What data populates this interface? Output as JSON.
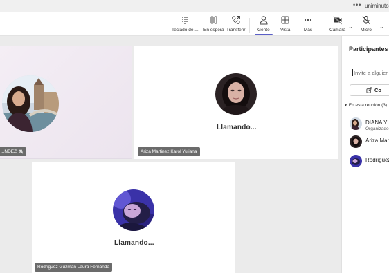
{
  "browser": {
    "menu_dots": "•••",
    "domain": "uniminuto.e"
  },
  "toolbar": {
    "items": [
      {
        "label": "Teclado de ...",
        "icon": "dialpad-icon"
      },
      {
        "label": "En espera",
        "icon": "pause-icon"
      },
      {
        "label": "Transferir",
        "icon": "transfer-call-icon"
      },
      {
        "label": "Gente",
        "icon": "people-icon"
      },
      {
        "label": "Vista",
        "icon": "view-grid-icon"
      },
      {
        "label": "Más",
        "icon": "more-icon"
      },
      {
        "label": "Cámara",
        "icon": "camera-off-icon"
      },
      {
        "label": "Micro",
        "icon": "mic-off-icon"
      }
    ],
    "active_item": "Gente",
    "accent_color": "#5b5fc7"
  },
  "stage": {
    "tiles": [
      {
        "name": "...NDEZ",
        "status": "",
        "muted": true
      },
      {
        "name": "Ariza Martinez Karol Yuliana",
        "status": "Llamando..."
      },
      {
        "name": "Rodriguez Guzman Laura Fernanda",
        "status": "Llamando..."
      }
    ]
  },
  "panel": {
    "title": "Participantes",
    "invite_placeholder": "Invite a alguien",
    "share_label": "Co",
    "section_label": "En esta reunión (3)",
    "participants": [
      {
        "name": "DIANA YU",
        "role": "Organizado"
      },
      {
        "name": "Ariza Mar",
        "role": ""
      },
      {
        "name": "Rodriguez",
        "role": ""
      }
    ]
  }
}
